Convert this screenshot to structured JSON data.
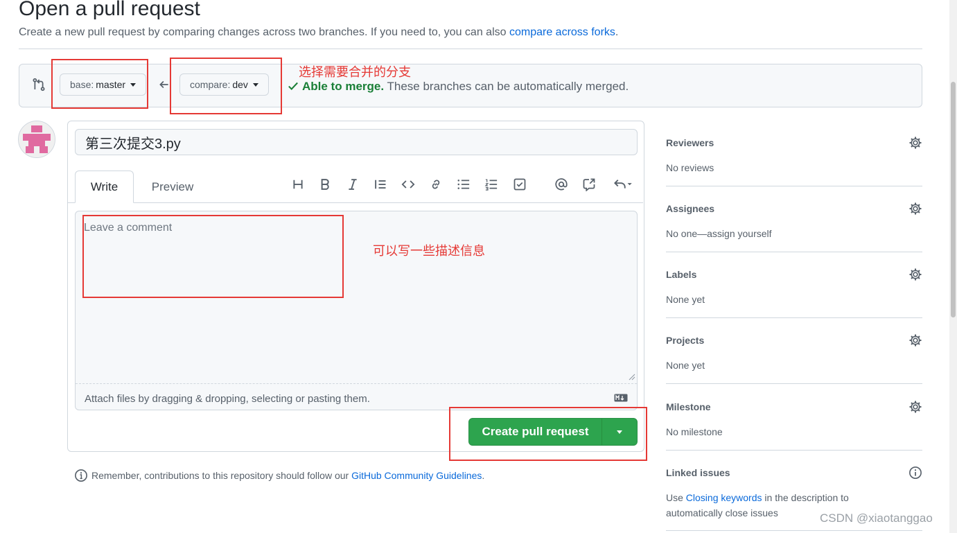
{
  "header": {
    "title": "Open a pull request",
    "subtitle_prefix": "Create a new pull request by comparing changes across two branches. If you need to, you can also ",
    "subtitle_link": "compare across forks",
    "subtitle_suffix": "."
  },
  "compare": {
    "base_label": "base:",
    "base_value": "master",
    "compare_label": "compare:",
    "compare_value": "dev",
    "merge_ok": "Able to merge.",
    "merge_text": " These branches can be automatically merged."
  },
  "annotations": {
    "branch_note": "选择需要合并的分支",
    "comment_note": "可以写一些描述信息"
  },
  "form": {
    "title_value": "第三次提交3.py",
    "tabs": [
      "Write",
      "Preview"
    ],
    "comment_placeholder": "Leave a comment",
    "attach_text": "Attach files by dragging & dropping, selecting or pasting them.",
    "submit_label": "Create pull request"
  },
  "toolbar_icons": [
    "heading-icon",
    "bold-icon",
    "italic-icon",
    "quote-icon",
    "code-icon",
    "link-icon",
    "unordered-list-icon",
    "ordered-list-icon",
    "task-list-icon",
    "mention-icon",
    "reference-icon",
    "reply-icon"
  ],
  "guidelines": {
    "prefix": "Remember, contributions to this repository should follow our ",
    "link": "GitHub Community Guidelines",
    "suffix": "."
  },
  "sidebar": {
    "reviewers": {
      "title": "Reviewers",
      "value": "No reviews"
    },
    "assignees": {
      "title": "Assignees",
      "value": "No one—assign yourself"
    },
    "labels": {
      "title": "Labels",
      "value": "None yet"
    },
    "projects": {
      "title": "Projects",
      "value": "None yet"
    },
    "milestone": {
      "title": "Milestone",
      "value": "No milestone"
    },
    "linked_issues": {
      "title": "Linked issues",
      "value_prefix": "Use ",
      "value_link": "Closing keywords",
      "value_suffix": " in the description to automatically close issues"
    }
  },
  "watermark": "CSDN @xiaotanggao",
  "colors": {
    "accent_green": "#2da44e",
    "link_blue": "#0969da",
    "annotation_red": "#e53935"
  }
}
